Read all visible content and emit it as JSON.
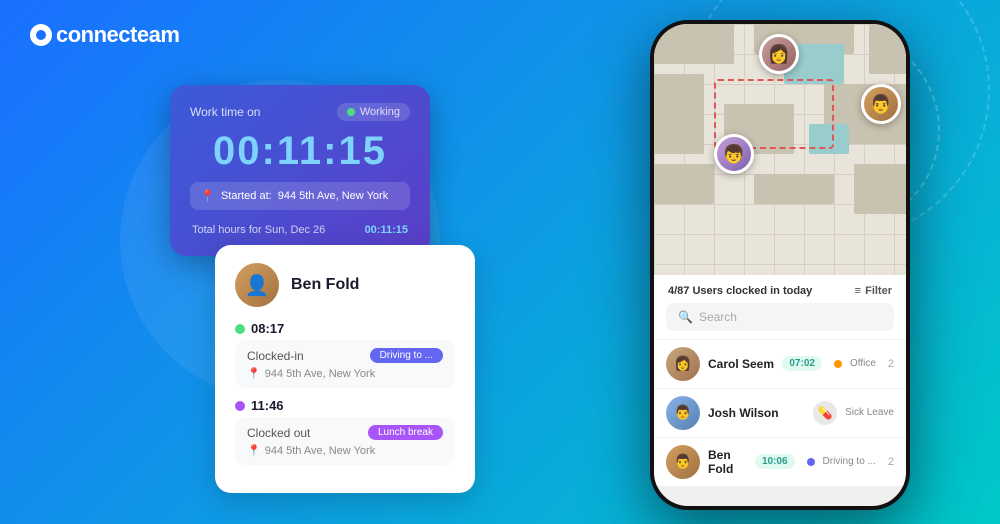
{
  "brand": {
    "name": "connecteam",
    "logo_text": "connecteam"
  },
  "work_time_card": {
    "label": "Work time on",
    "status": "Working",
    "timer": "00:11:15",
    "started_label": "Started at:",
    "started_location": "944 5th Ave, New York",
    "total_label": "Total hours for Sun, Dec 26",
    "total_time": "00:11:15"
  },
  "user_card": {
    "name": "Ben Fold",
    "timeline": [
      {
        "time": "08:17",
        "action": "Clocked-in",
        "badge": "Driving to ...",
        "location": "944 5th Ave, New York",
        "dot_color": "green"
      },
      {
        "time": "11:46",
        "action": "Clocked out",
        "badge": "Lunch break",
        "location": "944 5th Ave, New York",
        "dot_color": "purple"
      }
    ]
  },
  "phone": {
    "map": {
      "users_clocked_label": "4/87 Users clocked in today"
    },
    "list": {
      "filter_label": "Filter",
      "search_placeholder": "Search",
      "items": [
        {
          "name": "Carol Seem",
          "time": "07:02",
          "status_color": "#ff9500",
          "status_label": "Office",
          "count": "2"
        },
        {
          "name": "Josh Wilson",
          "time": "",
          "status_color": "",
          "status_label": "Sick Leave",
          "count": ""
        },
        {
          "name": "Ben Fold",
          "time": "10:06",
          "status_color": "#6366f1",
          "status_label": "Driving to ...",
          "count": "2"
        }
      ]
    }
  }
}
